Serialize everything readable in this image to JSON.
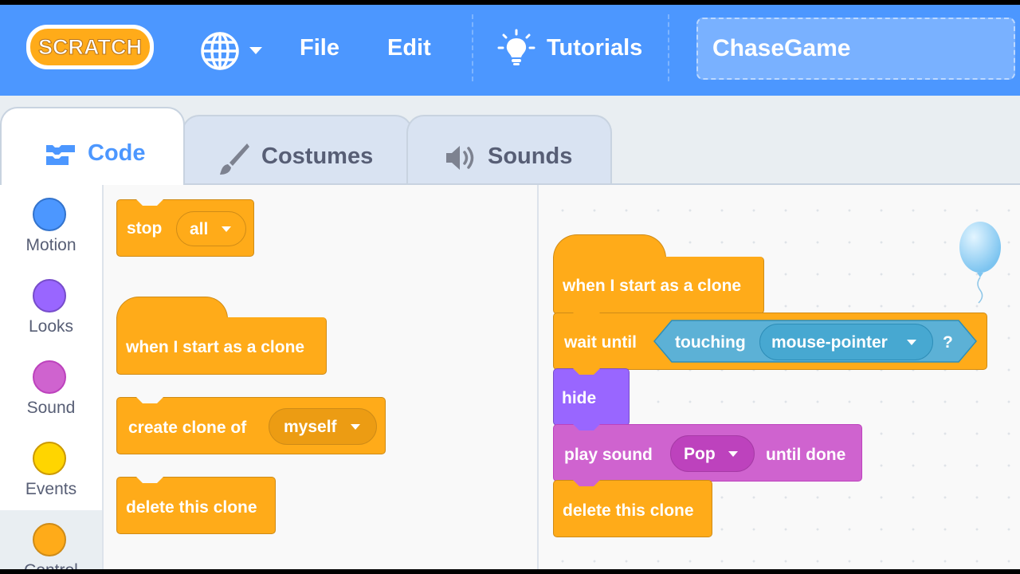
{
  "menubar": {
    "logo_text": "SCRATCH",
    "globe_icon": "globe-icon",
    "file_label": "File",
    "edit_label": "Edit",
    "tutorials_label": "Tutorials",
    "project_title": "ChaseGame"
  },
  "tabs": [
    {
      "label": "Code",
      "icon": "code-icon",
      "selected": true
    },
    {
      "label": "Costumes",
      "icon": "brush-icon",
      "selected": false
    },
    {
      "label": "Sounds",
      "icon": "speaker-icon",
      "selected": false
    }
  ],
  "categories": [
    {
      "label": "Motion",
      "color": "#4c97ff"
    },
    {
      "label": "Looks",
      "color": "#9966ff"
    },
    {
      "label": "Sound",
      "color": "#cf63cf"
    },
    {
      "label": "Events",
      "color": "#ffd500"
    },
    {
      "label": "Control",
      "color": "#ffab19",
      "selected": true
    }
  ],
  "palette": {
    "stop": {
      "label": "stop",
      "option": "all"
    },
    "hat": {
      "label": "when I start as a clone"
    },
    "create_clone": {
      "label": "create clone of",
      "option": "myself"
    },
    "delete_clone": {
      "label": "delete this clone"
    }
  },
  "script": {
    "hat": {
      "label": "when I start as a clone"
    },
    "wait_until": {
      "label": "wait until",
      "sensing_label": "touching",
      "sensing_option": "mouse-pointer",
      "question_mark": "?"
    },
    "hide": {
      "label": "hide"
    },
    "play_sound": {
      "label": "play sound",
      "option": "Pop",
      "suffix": "until done"
    },
    "delete_clone": {
      "label": "delete this clone"
    }
  },
  "colors": {
    "menubar": "#4c97ff",
    "control": "#ffab19",
    "looks": "#9966ff",
    "sound": "#cf63cf",
    "sensing": "#5cb1d6"
  }
}
